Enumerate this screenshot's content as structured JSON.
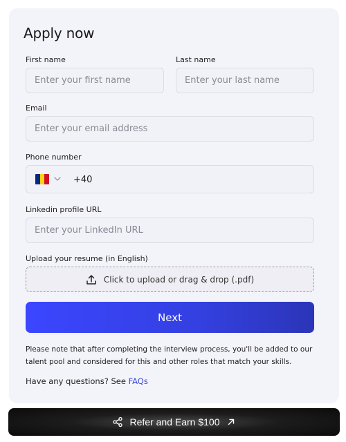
{
  "form": {
    "title": "Apply now",
    "first_name": {
      "label": "First name",
      "placeholder": "Enter your first name"
    },
    "last_name": {
      "label": "Last name",
      "placeholder": "Enter your last name"
    },
    "email": {
      "label": "Email",
      "placeholder": "Enter your email address"
    },
    "phone": {
      "label": "Phone number",
      "country_flag": "romania-flag",
      "flag_colors": [
        "#002b7f",
        "#fcd116",
        "#ce1126"
      ],
      "value": "+40"
    },
    "linkedin": {
      "label": "Linkedin profile URL",
      "placeholder": "Enter your LinkedIn URL"
    },
    "resume": {
      "label": "Upload your resume (in English)",
      "upload_text": "Click to upload or drag & drop (.pdf)",
      "icon": "upload-icon"
    },
    "next_label": "Next",
    "note": "Please note that after completing the interview process, you'll be added to our talent pool and considered for this and other roles that match your skills.",
    "questions_text": "Have any questions? See ",
    "faq_link": "FAQs"
  },
  "refer": {
    "label": "Refer and Earn $100",
    "icons": [
      "share-icon",
      "arrow-up-right-icon"
    ]
  },
  "colors": {
    "accent": "#3b46ff",
    "card_bg": "#f3f3fa",
    "link": "#3a46d8"
  }
}
